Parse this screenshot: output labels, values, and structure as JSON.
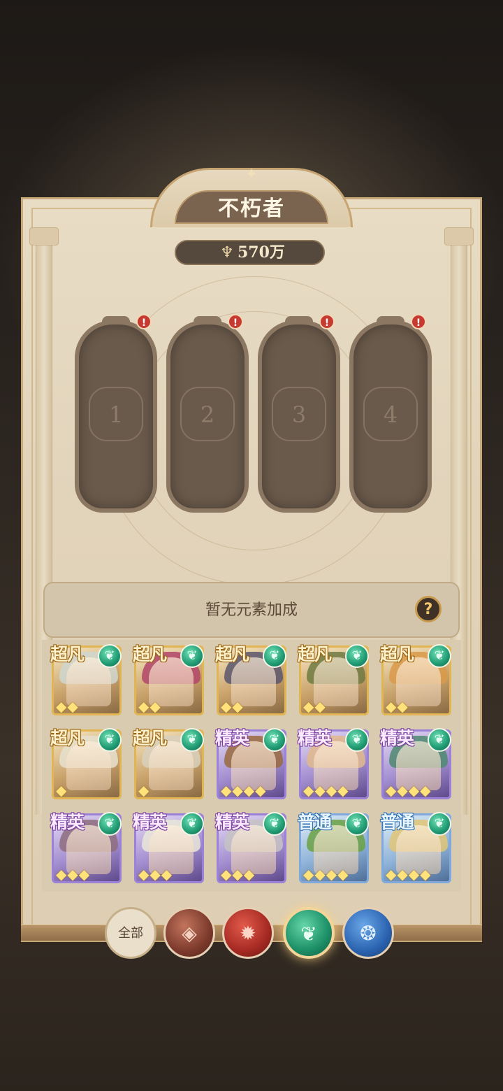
{
  "title": "不朽者",
  "power": {
    "value": "570万",
    "icon": "trident-icon"
  },
  "slots": [
    {
      "number": "1",
      "alert": "!"
    },
    {
      "number": "2",
      "alert": "!"
    },
    {
      "number": "3",
      "alert": "!"
    },
    {
      "number": "4",
      "alert": "!"
    }
  ],
  "bonus": {
    "text": "暂无元素加成",
    "help": "?"
  },
  "heroes": [
    {
      "rarity": "超凡",
      "tier": "gold",
      "stars": 2,
      "element": "wind",
      "hair": "#cfd6d0"
    },
    {
      "rarity": "超凡",
      "tier": "gold",
      "stars": 2,
      "element": "wind",
      "hair": "#b2456a"
    },
    {
      "rarity": "超凡",
      "tier": "gold",
      "stars": 2,
      "element": "wind",
      "hair": "#5b566d"
    },
    {
      "rarity": "超凡",
      "tier": "gold",
      "stars": 2,
      "element": "wind",
      "hair": "#6e7a42"
    },
    {
      "rarity": "超凡",
      "tier": "gold",
      "stars": 2,
      "element": "wind",
      "hair": "#d99a4a"
    },
    {
      "rarity": "超凡",
      "tier": "gold",
      "stars": 1,
      "element": "wind",
      "hair": "#e6e1cf"
    },
    {
      "rarity": "超凡",
      "tier": "gold",
      "stars": 1,
      "element": "wind",
      "hair": "#d8d0bd"
    },
    {
      "rarity": "精英",
      "tier": "purple",
      "stars": 4,
      "element": "wind",
      "hair": "#9a6a3e"
    },
    {
      "rarity": "精英",
      "tier": "purple",
      "stars": 4,
      "element": "wind",
      "hair": "#e0b98c"
    },
    {
      "rarity": "精英",
      "tier": "purple",
      "stars": 4,
      "element": "wind",
      "hair": "#4f8a70"
    },
    {
      "rarity": "精英",
      "tier": "purple",
      "stars": 3,
      "element": "wind",
      "hair": "#8e6d7f"
    },
    {
      "rarity": "精英",
      "tier": "purple",
      "stars": 3,
      "element": "wind",
      "hair": "#e9e6d8"
    },
    {
      "rarity": "精英",
      "tier": "purple",
      "stars": 3,
      "element": "wind",
      "hair": "#c6c3c3"
    },
    {
      "rarity": "普通",
      "tier": "blue",
      "stars": 4,
      "element": "wind",
      "hair": "#6aa144"
    },
    {
      "rarity": "普通",
      "tier": "blue",
      "stars": 4,
      "element": "wind",
      "hair": "#e2c576"
    }
  ],
  "filters": [
    {
      "label": "全部",
      "kind": "all",
      "glyph": ""
    },
    {
      "label": "",
      "kind": "e1",
      "glyph": "◈",
      "icon": "rune-element-icon"
    },
    {
      "label": "",
      "kind": "e2",
      "glyph": "✹",
      "icon": "fire-element-icon"
    },
    {
      "label": "",
      "kind": "e3",
      "glyph": "❦",
      "icon": "wind-element-icon",
      "selected": true
    },
    {
      "label": "",
      "kind": "e4",
      "glyph": "❂",
      "icon": "water-element-icon"
    }
  ],
  "colors": {
    "gold_frame": "#e0b552",
    "purple_frame": "#9b82d8",
    "blue_frame": "#7fa9dd",
    "wind_green": "#1f9a72",
    "alert_red": "#c63a32"
  }
}
